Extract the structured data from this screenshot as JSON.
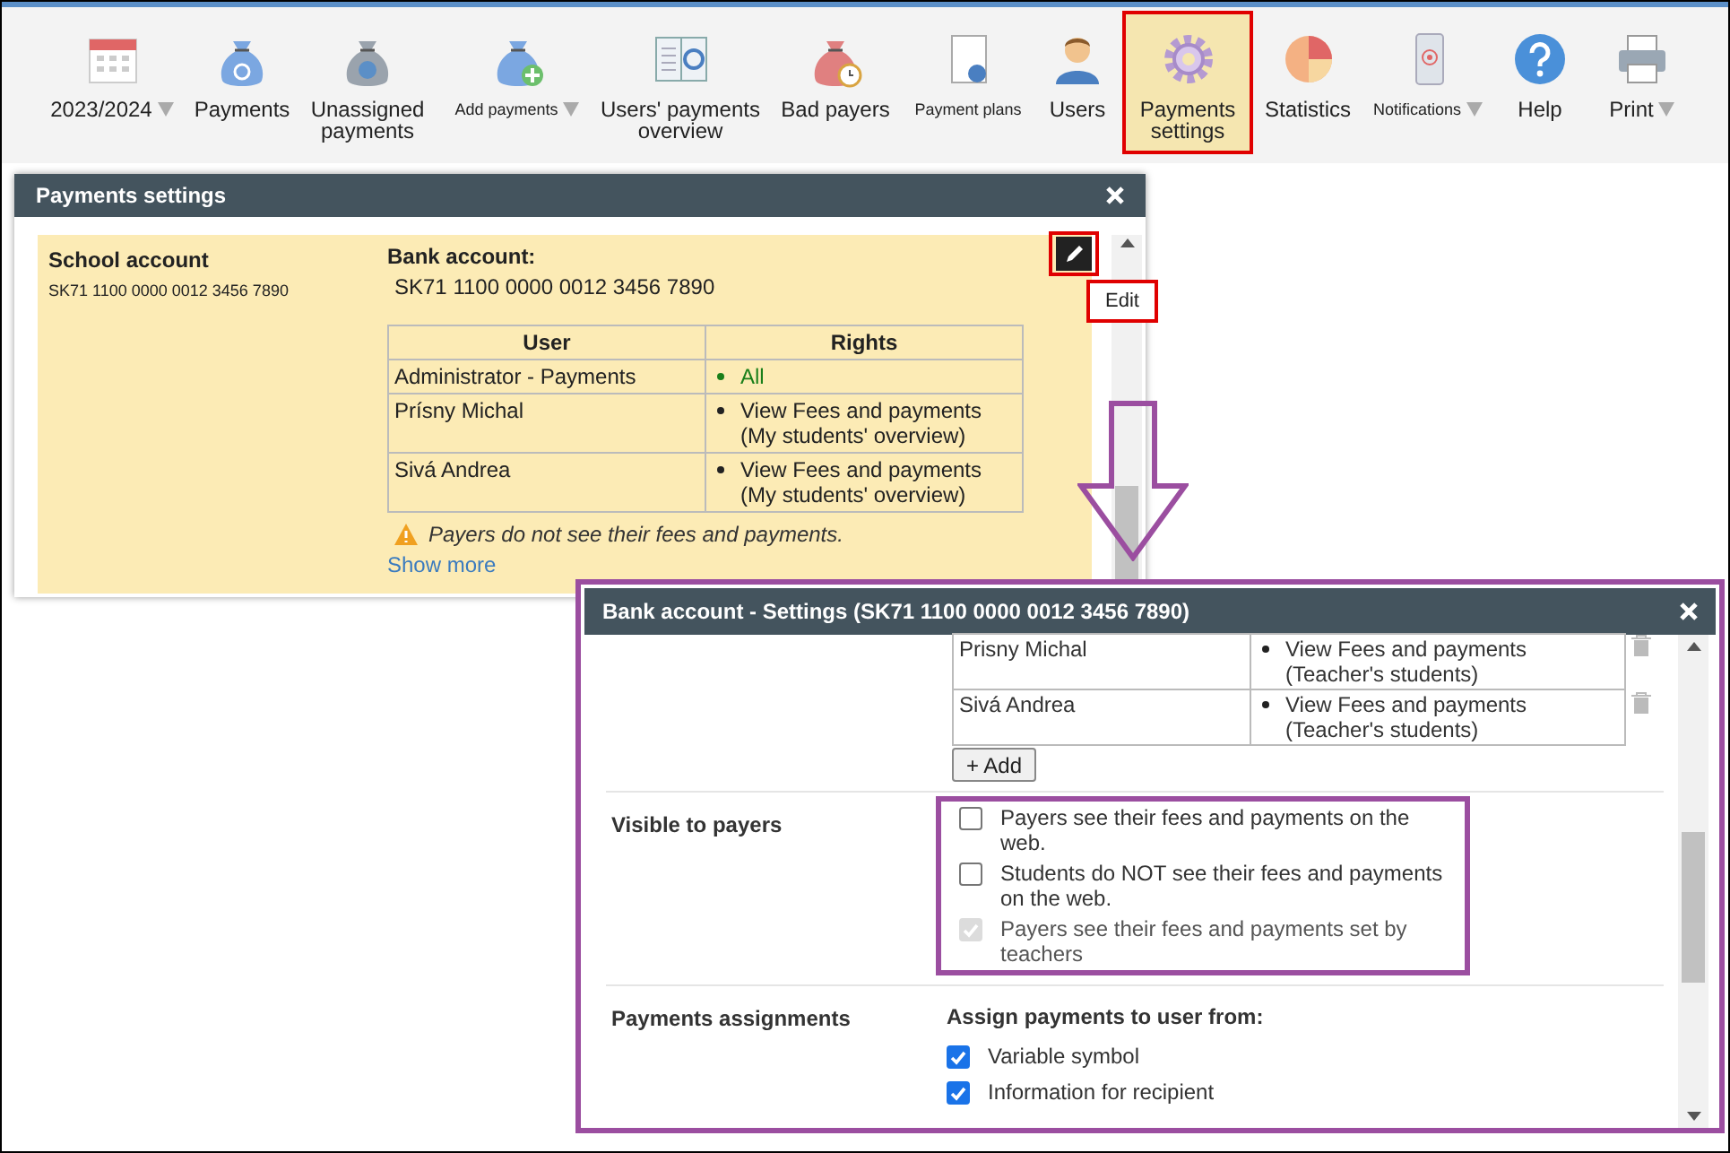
{
  "toolbar": {
    "items": [
      {
        "label": "2023/2024",
        "dropdown": true,
        "selected": false
      },
      {
        "label": "Payments",
        "dropdown": false,
        "selected": false
      },
      {
        "label": "Unassigned payments",
        "dropdown": false,
        "selected": false
      },
      {
        "label": "Add payments",
        "dropdown": true,
        "selected": false
      },
      {
        "label": "Users' payments overview",
        "dropdown": false,
        "selected": false
      },
      {
        "label": "Bad payers",
        "dropdown": false,
        "selected": false
      },
      {
        "label": "Payment plans",
        "dropdown": false,
        "selected": false
      },
      {
        "label": "Users",
        "dropdown": false,
        "selected": false
      },
      {
        "label": "Payments settings",
        "dropdown": false,
        "selected": true
      },
      {
        "label": "Statistics",
        "dropdown": false,
        "selected": false
      },
      {
        "label": "Notifications",
        "dropdown": true,
        "selected": false
      },
      {
        "label": "Help",
        "dropdown": false,
        "selected": false
      },
      {
        "label": "Print",
        "dropdown": true,
        "selected": false
      }
    ]
  },
  "window": {
    "title": "Payments settings",
    "account_name": "School account",
    "account_number": "SK71 1100 0000 0012 3456 7890",
    "bank_label": "Bank account:",
    "bank_number": "SK71 1100 0000 0012 3456 7890",
    "edit_tooltip": "Edit",
    "columns": [
      "User",
      "Rights"
    ],
    "rows": [
      {
        "user": "Administrator - Payments",
        "rights": [
          "All"
        ],
        "kind": "all"
      },
      {
        "user": "Prísny Michal",
        "rights": [
          "View Fees and payments",
          "(My students' overview)"
        ],
        "kind": "limited"
      },
      {
        "user": "Sivá Andrea",
        "rights": [
          "View Fees and payments",
          "(My students' overview)"
        ],
        "kind": "limited"
      }
    ],
    "warning": "Payers do not see their fees and payments.",
    "show_more": "Show more"
  },
  "dialog": {
    "title": "Bank account - Settings (SK71 1100 0000 0012 3456 7890)",
    "rows": [
      {
        "user": "Prisny Michal",
        "rights": [
          "View Fees and payments",
          "(Teacher's students)"
        ]
      },
      {
        "user": "Sivá Andrea",
        "rights": [
          "View Fees and payments",
          "(Teacher's students)"
        ]
      }
    ],
    "add_button": "+ Add",
    "sections": [
      {
        "label": "Visible to payers",
        "highlighted": true,
        "options": [
          {
            "label": "Payers see their fees and payments on the web.",
            "checked": false,
            "disabled": false
          },
          {
            "label": "Students do NOT see their fees and payments on the web.",
            "checked": false,
            "disabled": false
          },
          {
            "label": "Payers see their fees and payments set by teachers",
            "checked": true,
            "disabled": true
          }
        ]
      },
      {
        "label": "Payments assignments",
        "heading": "Assign payments to user from:",
        "highlighted": false,
        "options": [
          {
            "label": "Variable symbol",
            "checked": true,
            "disabled": false
          },
          {
            "label": "Information for recipient",
            "checked": true,
            "disabled": false
          }
        ]
      }
    ]
  }
}
